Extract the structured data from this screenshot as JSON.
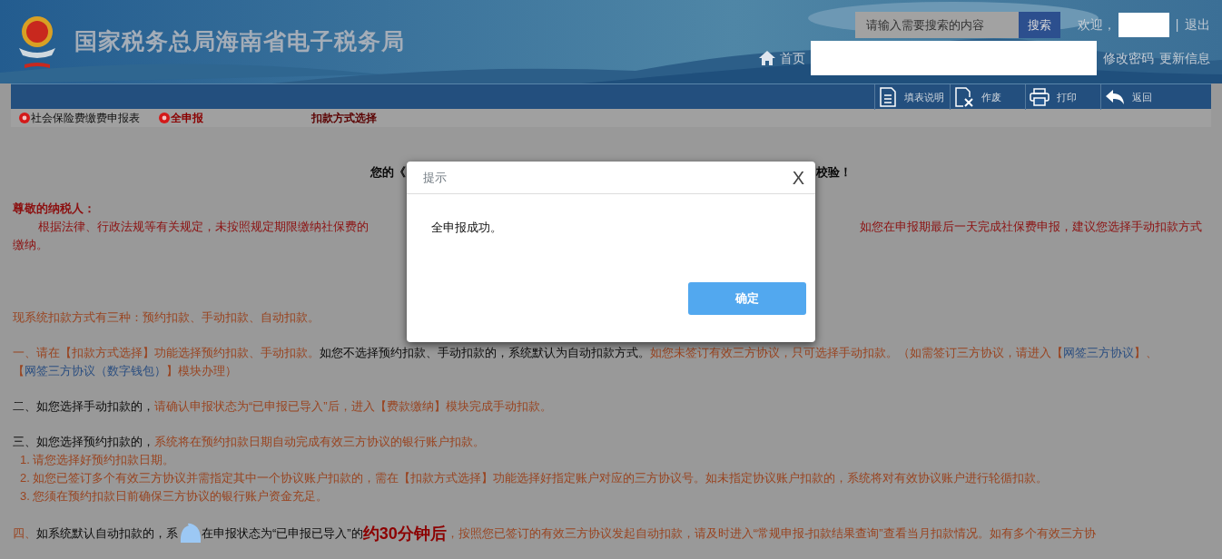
{
  "header": {
    "site_title": "国家税务总局海南省电子税务局",
    "search": {
      "placeholder": "请输入需要搜索的内容",
      "button": "搜索"
    },
    "welcome": "欢迎，",
    "separator": "|",
    "logout": "退出",
    "home": "首页",
    "links": [
      "修改密码",
      "更新信息"
    ]
  },
  "toolbar": [
    {
      "label": "填表说明",
      "kind": "guide"
    },
    {
      "label": "作废",
      "kind": "void"
    },
    {
      "label": "打印",
      "kind": "print"
    },
    {
      "label": "返回",
      "kind": "back"
    }
  ],
  "breadcrumb": [
    {
      "label": "社会保险费缴费申报表",
      "kind": "form"
    },
    {
      "label": "全申报",
      "kind": "current"
    },
    {
      "label": "扣款方式选择",
      "kind": "step"
    }
  ],
  "notice": {
    "heading_left": "您的《",
    "heading_right": "校验！",
    "greeting": "尊敬的纳税人：",
    "para_left": "根据法律、行政法规等有关规定，未按照规定期限缴纳社保费的",
    "para_right": "如您在申报期最后一天完成社保费申报，建议您选择手动扣款方式",
    "para_tail": "缴纳。",
    "intro": "现系统扣款方式有三种：预约扣款、手动扣款、自动扣款。",
    "items": [
      {
        "segments": [
          {
            "kind": "text",
            "text": "一、请在【扣款方式选择】功能选择预约扣款、手动扣款。",
            "color": "#994420"
          },
          {
            "kind": "text",
            "text": "如您不选择预约扣款、手动扣款的，系统默认为自动扣款方式。",
            "color": "#0a0a0a"
          },
          {
            "kind": "text",
            "text": "如您未签订有效三方协议，只可选择手动扣款。（如需签订三方协议，请进入【",
            "color": "#994420"
          },
          {
            "kind": "link",
            "text": "网签三方协议",
            "color": "#2c4f80"
          },
          {
            "kind": "text",
            "text": "】、【",
            "color": "#994420"
          },
          {
            "kind": "link",
            "text": "网签三方协议（数字钱包）",
            "color": "#2c4f80"
          },
          {
            "kind": "text",
            "text": "】模块办理）",
            "color": "#994420"
          }
        ]
      },
      {
        "segments": [
          {
            "kind": "text",
            "text": "二、如您选择手动扣款的，",
            "color": "#0a0a0a"
          },
          {
            "kind": "text",
            "text": "请确认申报状态为“已申报已导入”后，进入【费款缴纳】模块完成手动扣款。",
            "color": "#994420"
          }
        ]
      },
      {
        "segments": [
          {
            "kind": "text",
            "text": "三、如您选择预约扣款的，",
            "color": "#0a0a0a"
          },
          {
            "kind": "text",
            "text": "系统将在预约扣款日期自动完成有效三方协议的银行账户扣款。",
            "color": "#994420"
          }
        ],
        "subitems": [
          "1. 请您选择好预约扣款日期。",
          "2. 如您已签订多个有效三方协议并需指定其中一个协议账户扣款的，需在【扣款方式选择】功能选择好指定账户对应的三方协议号。如未指定协议账户扣款的，系统将对有效协议账户进行轮循扣款。",
          "3. 您须在预约扣款日前确保三方协议的银行账户资金充足。"
        ]
      },
      {
        "segments": [
          {
            "kind": "text",
            "text": "四、",
            "color": "#994420"
          },
          {
            "kind": "text",
            "text": "如系统默认自动扣款的，系",
            "color": "#0a0a0a"
          },
          {
            "kind": "icon"
          },
          {
            "kind": "text",
            "text": "在申报状态为“已申报已导入”的",
            "color": "#0a0a0a"
          },
          {
            "kind": "emphasis",
            "text": "约30分钟后",
            "color": "#8c0000"
          },
          {
            "kind": "text",
            "text": "，按照您已签订的有效三方协议发起自动扣款，请及时进入“常规申报-扣款结果查询”查看当月扣款情况。如有多个有效三方协",
            "color": "#994420"
          }
        ]
      }
    ]
  },
  "dialog": {
    "title": "提示",
    "close": "X",
    "message": "全申报成功。",
    "button": "确定"
  }
}
